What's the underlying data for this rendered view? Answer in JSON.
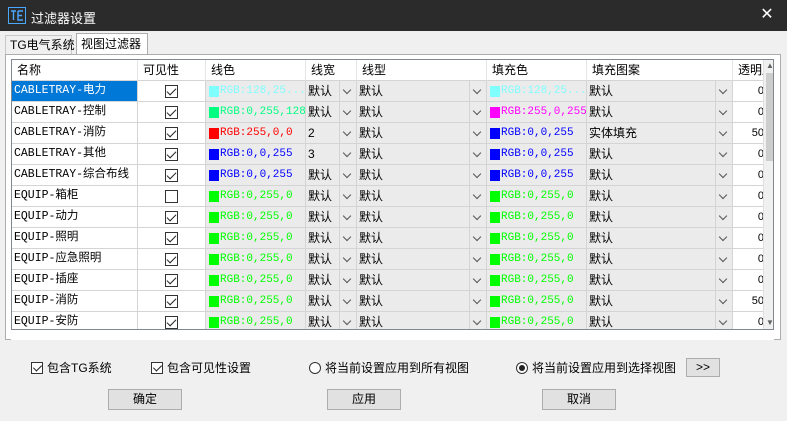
{
  "window": {
    "title": "过滤器设置"
  },
  "tabs": [
    {
      "label": "TG电气系统",
      "active": false
    },
    {
      "label": "视图过滤器",
      "active": true
    }
  ],
  "table": {
    "headers": [
      "名称",
      "可见性",
      "线色",
      "线宽",
      "线型",
      "填充色",
      "填充图案",
      "透明度"
    ],
    "rows": [
      {
        "name": "CABLETRAY-电力",
        "visible": true,
        "line_color": "RGB:128,25...",
        "line_hex": "#80ffff",
        "line_width": "默认",
        "line_type": "默认",
        "fill_color": "RGB:128,25...",
        "fill_hex": "#80ffff",
        "fill_pattern": "默认",
        "transparency": "0",
        "selected": true
      },
      {
        "name": "CABLETRAY-控制",
        "visible": true,
        "line_color": "RGB:0,255,128",
        "line_hex": "#00ff80",
        "line_width": "默认",
        "line_type": "默认",
        "fill_color": "RGB:255,0,255",
        "fill_hex": "#ff00ff",
        "fill_pattern": "默认",
        "transparency": "0",
        "selected": false
      },
      {
        "name": "CABLETRAY-消防",
        "visible": true,
        "line_color": "RGB:255,0,0",
        "line_hex": "#ff0000",
        "line_width": "2",
        "line_type": "默认",
        "fill_color": "RGB:0,0,255",
        "fill_hex": "#0000ff",
        "fill_pattern": "实体填充",
        "transparency": "50",
        "selected": false
      },
      {
        "name": "CABLETRAY-其他",
        "visible": true,
        "line_color": "RGB:0,0,255",
        "line_hex": "#0000ff",
        "line_width": "3",
        "line_type": "默认",
        "fill_color": "RGB:0,0,255",
        "fill_hex": "#0000ff",
        "fill_pattern": "默认",
        "transparency": "0",
        "selected": false
      },
      {
        "name": "CABLETRAY-综合布线",
        "visible": true,
        "line_color": "RGB:0,0,255",
        "line_hex": "#0000ff",
        "line_width": "默认",
        "line_type": "默认",
        "fill_color": "RGB:0,0,255",
        "fill_hex": "#0000ff",
        "fill_pattern": "默认",
        "transparency": "0",
        "selected": false
      },
      {
        "name": "EQUIP-箱柜",
        "visible": false,
        "line_color": "RGB:0,255,0",
        "line_hex": "#00ff00",
        "line_width": "默认",
        "line_type": "默认",
        "fill_color": "RGB:0,255,0",
        "fill_hex": "#00ff00",
        "fill_pattern": "默认",
        "transparency": "0",
        "selected": false
      },
      {
        "name": "EQUIP-动力",
        "visible": true,
        "line_color": "RGB:0,255,0",
        "line_hex": "#00ff00",
        "line_width": "默认",
        "line_type": "默认",
        "fill_color": "RGB:0,255,0",
        "fill_hex": "#00ff00",
        "fill_pattern": "默认",
        "transparency": "0",
        "selected": false
      },
      {
        "name": "EQUIP-照明",
        "visible": true,
        "line_color": "RGB:0,255,0",
        "line_hex": "#00ff00",
        "line_width": "默认",
        "line_type": "默认",
        "fill_color": "RGB:0,255,0",
        "fill_hex": "#00ff00",
        "fill_pattern": "默认",
        "transparency": "0",
        "selected": false
      },
      {
        "name": "EQUIP-应急照明",
        "visible": true,
        "line_color": "RGB:0,255,0",
        "line_hex": "#00ff00",
        "line_width": "默认",
        "line_type": "默认",
        "fill_color": "RGB:0,255,0",
        "fill_hex": "#00ff00",
        "fill_pattern": "默认",
        "transparency": "0",
        "selected": false
      },
      {
        "name": "EQUIP-插座",
        "visible": true,
        "line_color": "RGB:0,255,0",
        "line_hex": "#00ff00",
        "line_width": "默认",
        "line_type": "默认",
        "fill_color": "RGB:0,255,0",
        "fill_hex": "#00ff00",
        "fill_pattern": "默认",
        "transparency": "0",
        "selected": false
      },
      {
        "name": "EQUIP-消防",
        "visible": true,
        "line_color": "RGB:0,255,0",
        "line_hex": "#00ff00",
        "line_width": "默认",
        "line_type": "默认",
        "fill_color": "RGB:0,255,0",
        "fill_hex": "#00ff00",
        "fill_pattern": "默认",
        "transparency": "50",
        "selected": false
      },
      {
        "name": "EQUIP-安防",
        "visible": true,
        "line_color": "RGB:0,255,0",
        "line_hex": "#00ff00",
        "line_width": "默认",
        "line_type": "默认",
        "fill_color": "RGB:0,255,0",
        "fill_hex": "#00ff00",
        "fill_pattern": "默认",
        "transparency": "0",
        "selected": false
      }
    ]
  },
  "options": {
    "include_tg": {
      "label": "包含TG系统",
      "checked": true
    },
    "include_visibility": {
      "label": "包含可见性设置",
      "checked": true
    },
    "apply_all_views": {
      "label": "将当前设置应用到所有视图",
      "selected": false
    },
    "apply_selected_views": {
      "label": "将当前设置应用到选择视图",
      "selected": true
    },
    "more_button": ">>"
  },
  "buttons": {
    "ok": "确定",
    "apply": "应用",
    "cancel": "取消"
  }
}
